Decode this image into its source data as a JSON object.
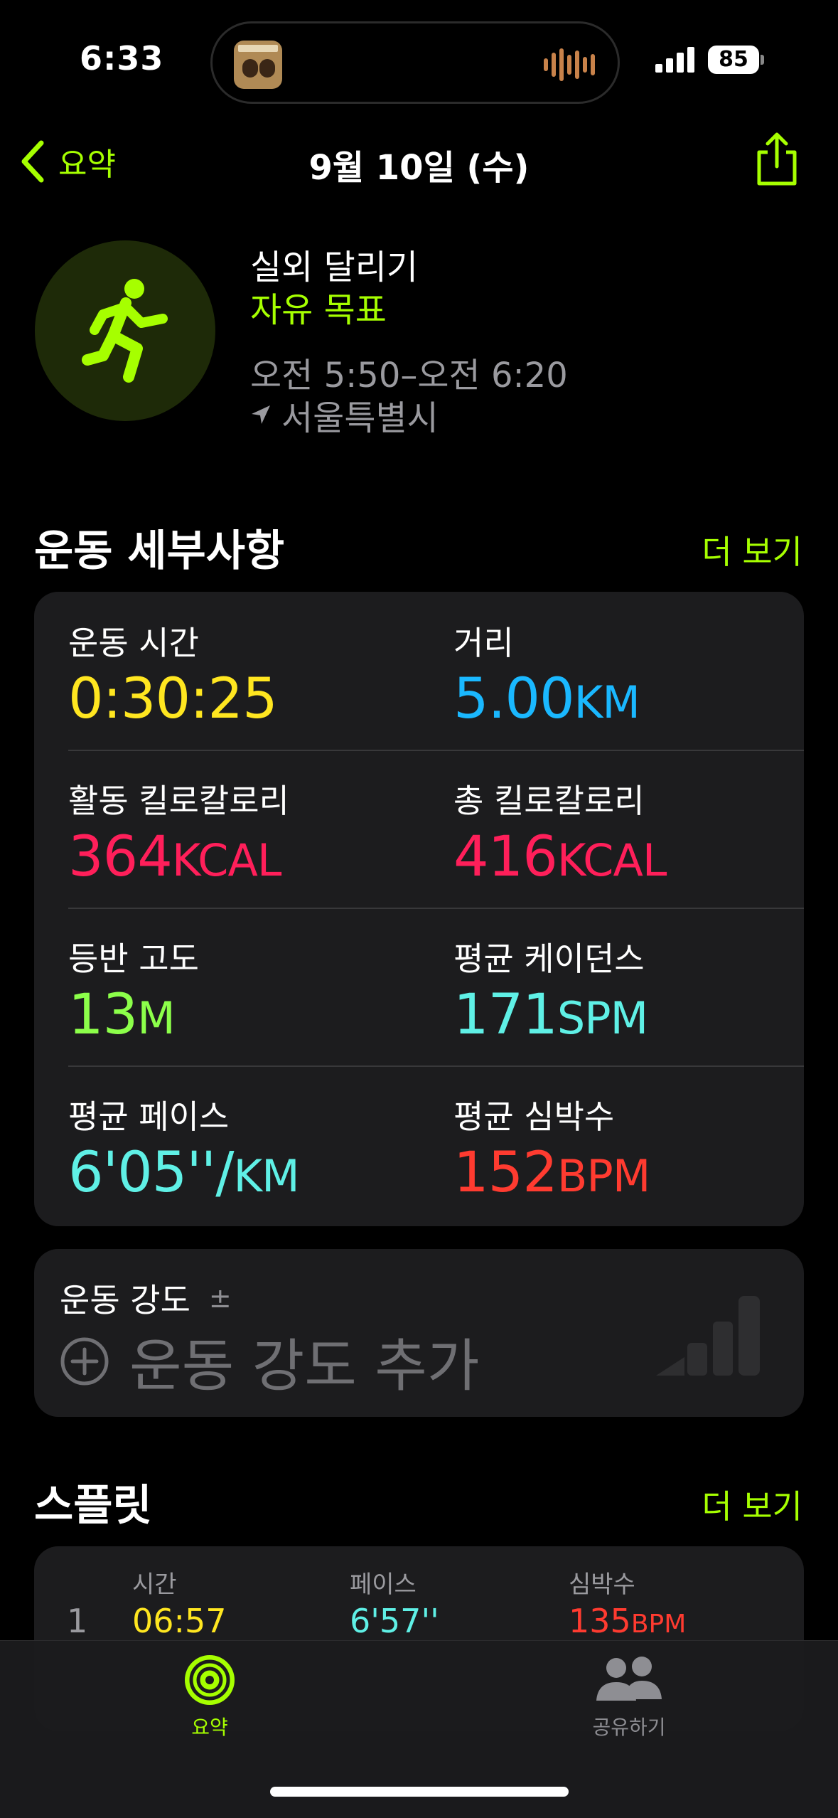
{
  "status": {
    "time": "6:33",
    "battery": "85"
  },
  "nav": {
    "back_label": "요약",
    "title": "9월 10일 (수)"
  },
  "workout": {
    "name": "실외 달리기",
    "goal": "자유 목표",
    "time_range": "오전 5:50–오전 6:20",
    "location": "서울특별시",
    "icon": "running-figure-icon"
  },
  "details": {
    "title": "운동 세부사항",
    "more": "더 보기",
    "metrics": [
      {
        "label": "운동 시간",
        "value": "0:30:25",
        "unit": "",
        "color": "#ffe620"
      },
      {
        "label": "거리",
        "value": "5.00",
        "unit": "KM",
        "color": "#1ab8ff"
      },
      {
        "label": "활동 킬로칼로리",
        "value": "364",
        "unit": "KCAL",
        "color": "#ff1f5a"
      },
      {
        "label": "총 킬로칼로리",
        "value": "416",
        "unit": "KCAL",
        "color": "#ff1f5a"
      },
      {
        "label": "등반 고도",
        "value": "13",
        "unit": "M",
        "color": "#8cff4a"
      },
      {
        "label": "평균 케이던스",
        "value": "171",
        "unit": "SPM",
        "color": "#5ff0e6"
      },
      {
        "label": "평균 페이스",
        "value": "6'05''/",
        "unit": "KM",
        "color": "#5ff0e6"
      },
      {
        "label": "평균 심박수",
        "value": "152",
        "unit": "BPM",
        "color": "#ff3b30"
      }
    ]
  },
  "intensity": {
    "label": "운동 강도",
    "pm": "±",
    "add": "운동 강도 추가"
  },
  "splits": {
    "title": "스플릿",
    "more": "더 보기",
    "headers": {
      "time": "시간",
      "pace": "페이스",
      "hr": "심박수"
    },
    "rows": [
      {
        "index": "1",
        "time": "06:57",
        "pace": "6'57''",
        "hr": "135",
        "hr_unit": "BPM"
      }
    ]
  },
  "tabs": [
    {
      "label": "요약",
      "icon": "activity-rings-icon",
      "active": true
    },
    {
      "label": "공유하기",
      "icon": "people-icon",
      "active": false
    }
  ],
  "colors": {
    "accent": "#a6ff00",
    "yellow": "#ffe620",
    "cyan": "#5ff0e6",
    "red": "#ff3b30"
  }
}
